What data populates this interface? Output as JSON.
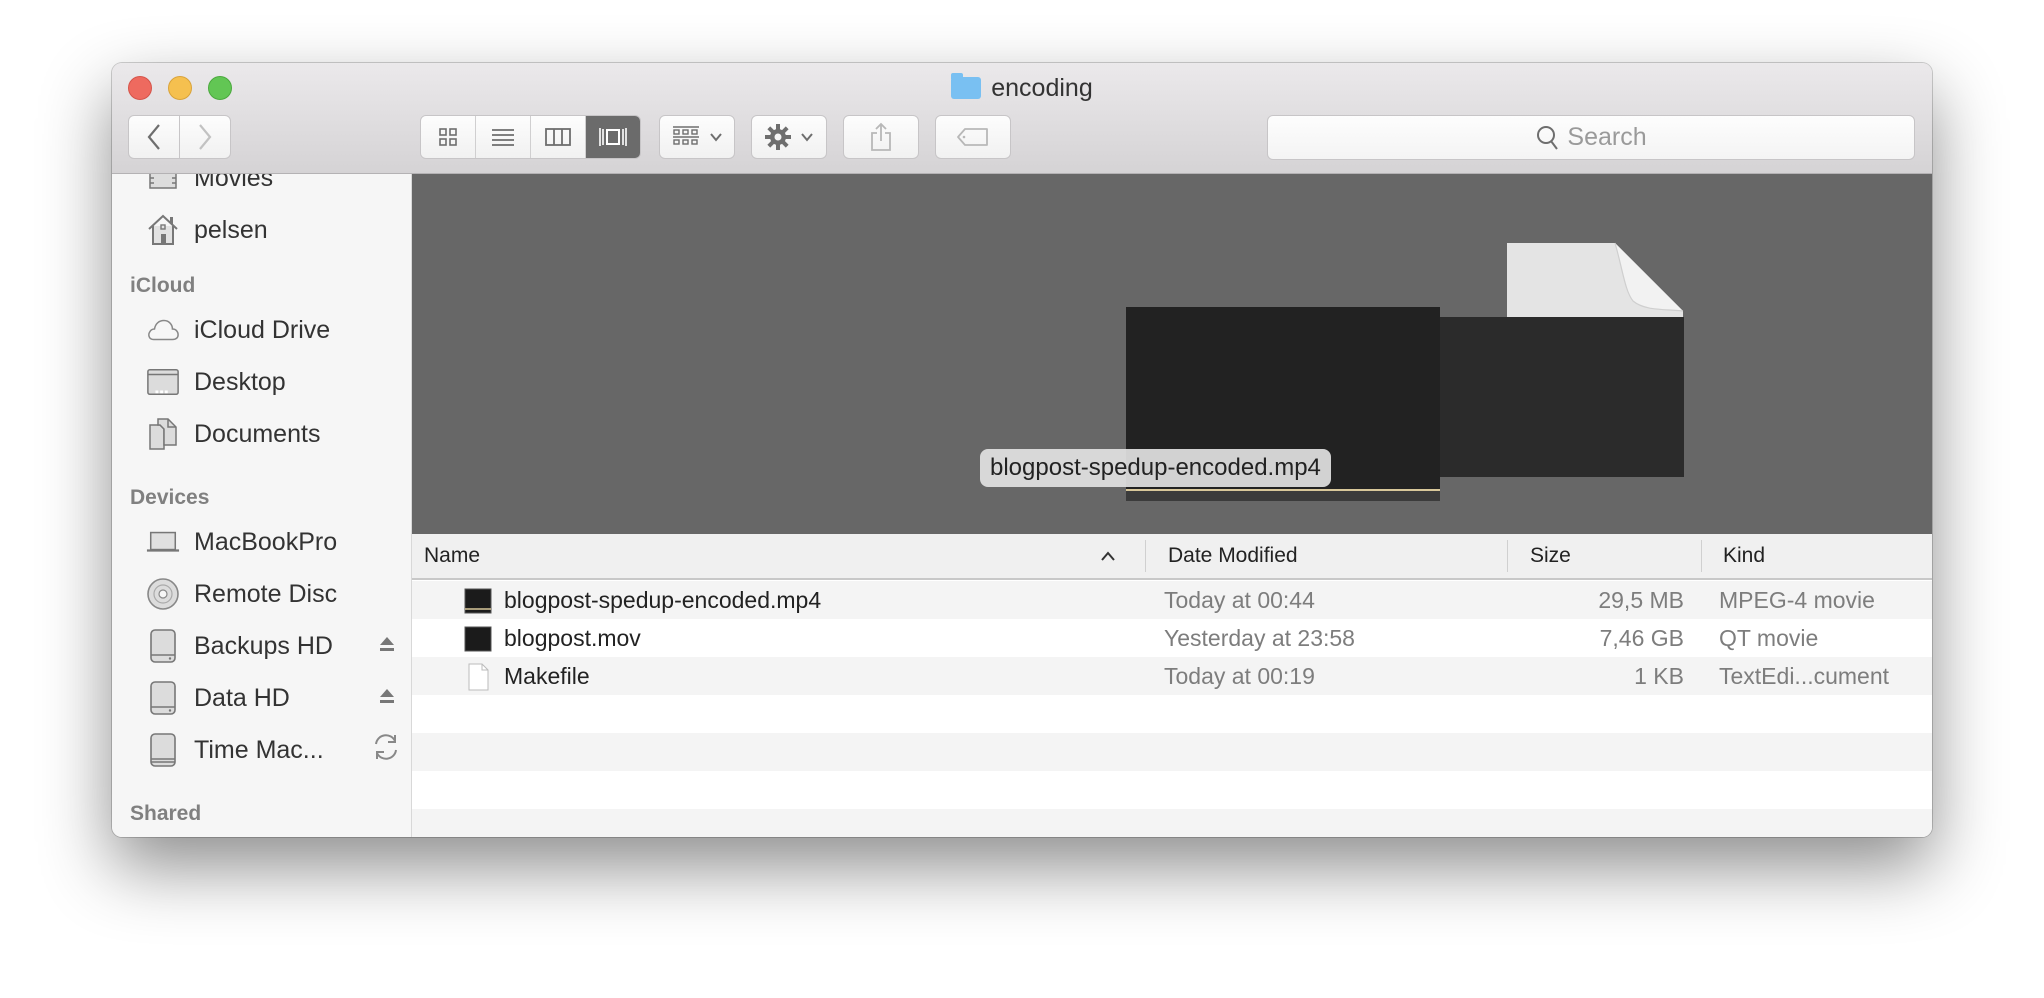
{
  "window": {
    "title": "encoding"
  },
  "toolbar": {
    "back_label": "Back",
    "forward_label": "Forward",
    "view_modes": [
      "icon-view",
      "list-view",
      "column-view",
      "cover-flow-view"
    ],
    "active_view": "cover-flow-view",
    "search_placeholder": "Search"
  },
  "sidebar": {
    "partial_top_item": "Movies",
    "favorites_tail": [
      {
        "label": "pelsen",
        "icon": "home-icon"
      }
    ],
    "sections": [
      {
        "heading": "iCloud",
        "items": [
          {
            "label": "iCloud Drive",
            "icon": "cloud-icon"
          },
          {
            "label": "Desktop",
            "icon": "desktop-icon"
          },
          {
            "label": "Documents",
            "icon": "documents-icon"
          }
        ]
      },
      {
        "heading": "Devices",
        "items": [
          {
            "label": "MacBookPro",
            "icon": "laptop-icon"
          },
          {
            "label": "Remote Disc",
            "icon": "disc-icon"
          },
          {
            "label": "Backups HD",
            "icon": "drive-icon",
            "action": "eject"
          },
          {
            "label": "Data HD",
            "icon": "drive-icon",
            "action": "eject"
          },
          {
            "label": "Time Mac...",
            "icon": "drive-icon",
            "action": "sync"
          }
        ]
      },
      {
        "heading": "Shared",
        "items": []
      }
    ]
  },
  "preview": {
    "selected_label": "blogpost-spedup-encoded.mp4"
  },
  "list": {
    "columns": [
      "Name",
      "Date Modified",
      "Size",
      "Kind"
    ],
    "sort_column": "Name",
    "sort_direction": "ascending",
    "rows": [
      {
        "name": "blogpost-spedup-encoded.mp4",
        "date": "Today at 00:44",
        "size": "29,5 MB",
        "kind": "MPEG-4 movie",
        "icon": "video-file-icon"
      },
      {
        "name": "blogpost.mov",
        "date": "Yesterday at 23:58",
        "size": "7,46 GB",
        "kind": "QT movie",
        "icon": "video-file-icon"
      },
      {
        "name": "Makefile",
        "date": "Today at 00:19",
        "size": "1 KB",
        "kind": "TextEdi...cument",
        "icon": "text-file-icon"
      }
    ]
  },
  "colors": {
    "close": "#ee6a5f",
    "minimize": "#f5c04f",
    "maximize": "#62c654",
    "preview_bg": "#676767",
    "folder": "#79c0f2"
  }
}
